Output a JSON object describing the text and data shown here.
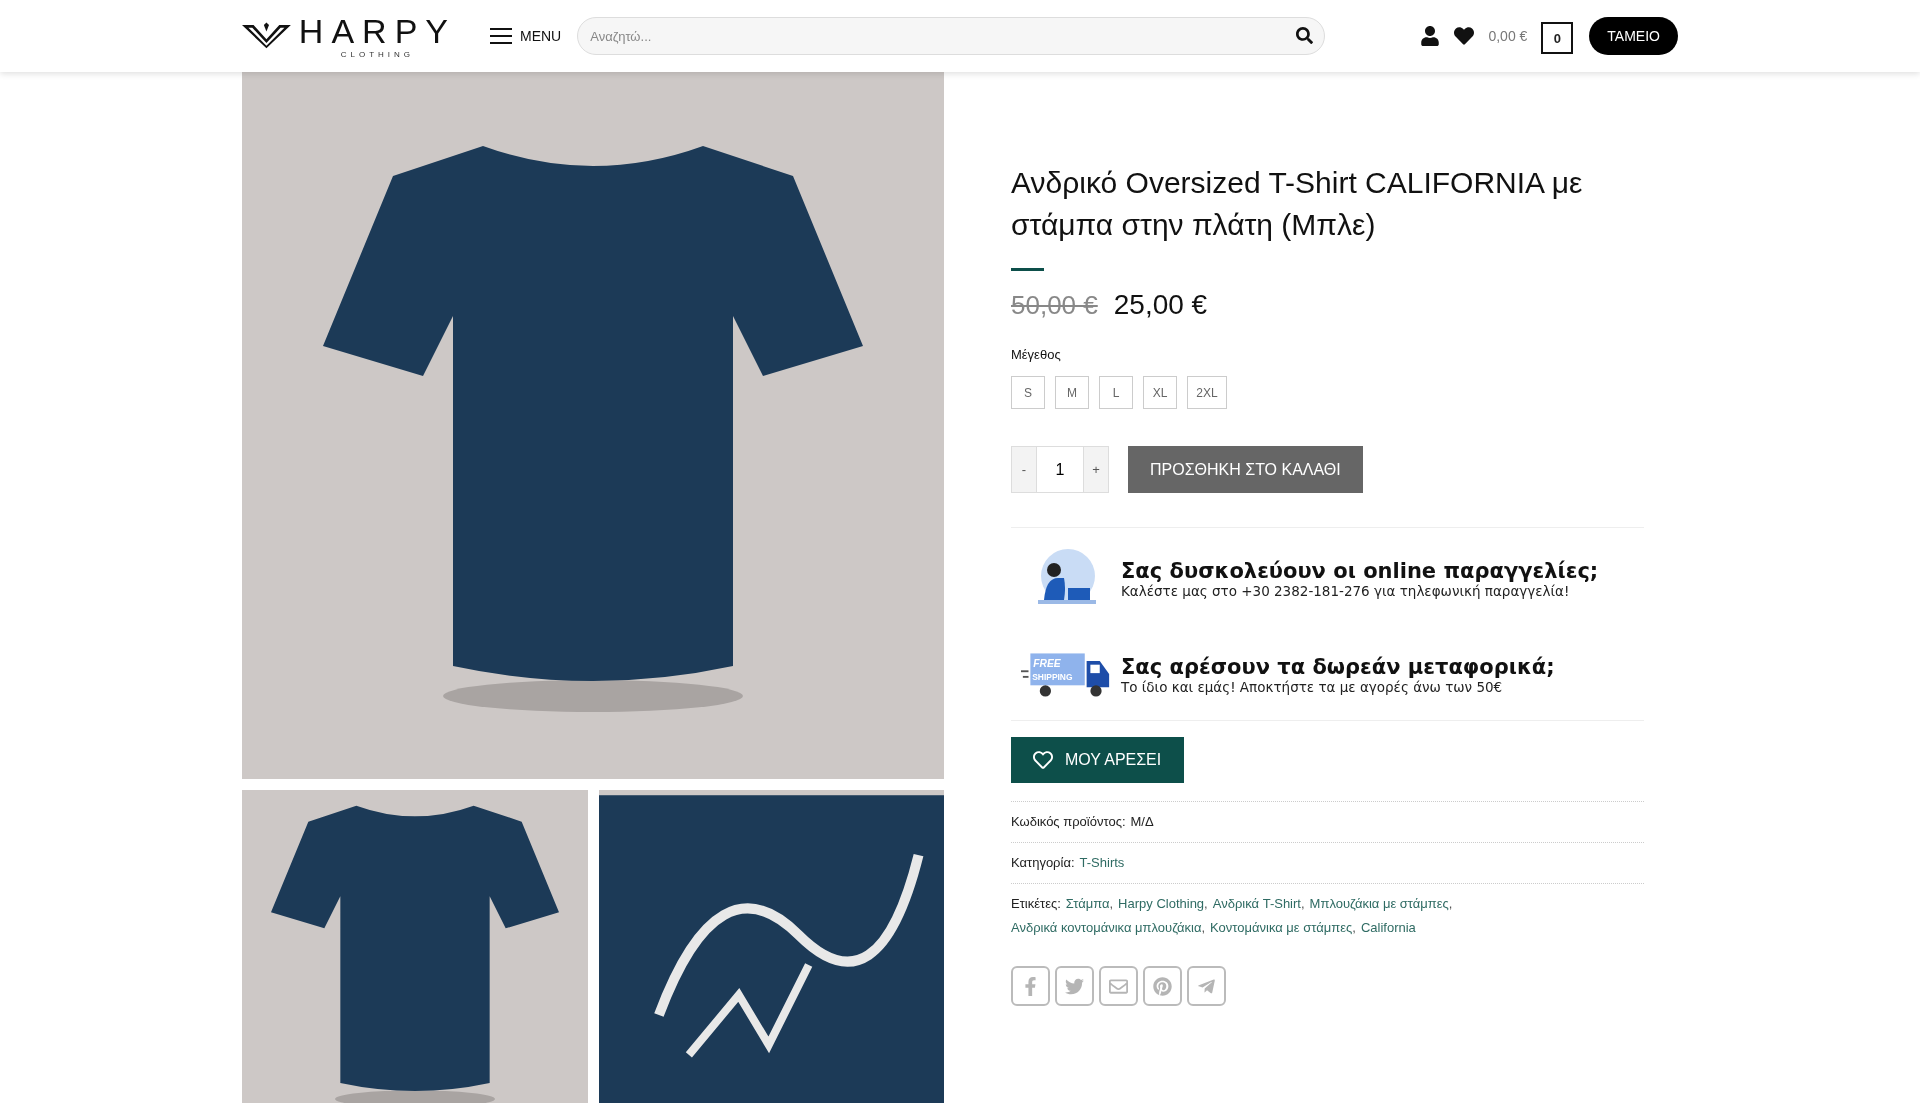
{
  "header": {
    "logo": {
      "name": "HARPY",
      "tagline": "CLOTHING"
    },
    "menu_label": "MENU",
    "search": {
      "placeholder": "Αναζητώ..."
    },
    "cart_total": "0,00 €",
    "cart_count": "0",
    "checkout_button": "ΤΑΜΕΙΟ"
  },
  "gallery": {
    "main_image": {
      "kind": "shirt-back"
    },
    "thumbnails": [
      {
        "kind": "shirt-front"
      },
      {
        "kind": "print-closeup"
      }
    ]
  },
  "product": {
    "title": "Ανδρικό Oversized T-Shirt CALIFORNIA με στάμπα στην πλάτη (Μπλε)",
    "old_price": "50,00 €",
    "price": "25,00 €",
    "size_label": "Μέγεθος",
    "sizes": [
      {
        "label": "S"
      },
      {
        "label": "M"
      },
      {
        "label": "L"
      },
      {
        "label": "XL"
      },
      {
        "label": "2XL"
      }
    ],
    "quantity": {
      "minus": "-",
      "value": "1",
      "plus": "+"
    },
    "add_to_cart": "ΠΡΟΣΘΗΚΗ ΣΤΟ ΚΑΛΑΘΙ",
    "promos": [
      {
        "kind": "phone",
        "title": "Σας δυσκολεύουν οι online παραγγελίες;",
        "text": "Καλέστε μας στο +30 2382-181-276 για τηλεφωνική παραγγελία!"
      },
      {
        "kind": "shipping",
        "badge": [
          "FREE",
          "SHIPPING"
        ],
        "title": "Σας αρέσουν τα δωρεάν μεταφορικά;",
        "text": "Το ίδιο και εμάς! Αποκτήστε τα με αγορές άνω των 50€"
      }
    ],
    "wishlist_button": "ΜΟΥ ΑΡΕΣΕΙ",
    "meta": {
      "sku": {
        "label": "Κωδικός προϊόντος:",
        "value": "Μ/Δ"
      },
      "category": {
        "label": "Κατηγορία:",
        "value": "T-Shirts"
      },
      "tags": {
        "label": "Ετικέτες:",
        "separator": ",",
        "items": [
          "Στάμπα",
          "Harpy Clothing",
          "Ανδρικά T-Shirt",
          "Μπλουζάκια με στάμπες",
          "Ανδρικά κοντομάνικα μπλουζάκια",
          "Κοντομάνικα με στάμπες",
          "California"
        ]
      }
    },
    "share": [
      {
        "kind": "facebook"
      },
      {
        "kind": "twitter"
      },
      {
        "kind": "email"
      },
      {
        "kind": "pinterest"
      },
      {
        "kind": "telegram"
      }
    ]
  }
}
